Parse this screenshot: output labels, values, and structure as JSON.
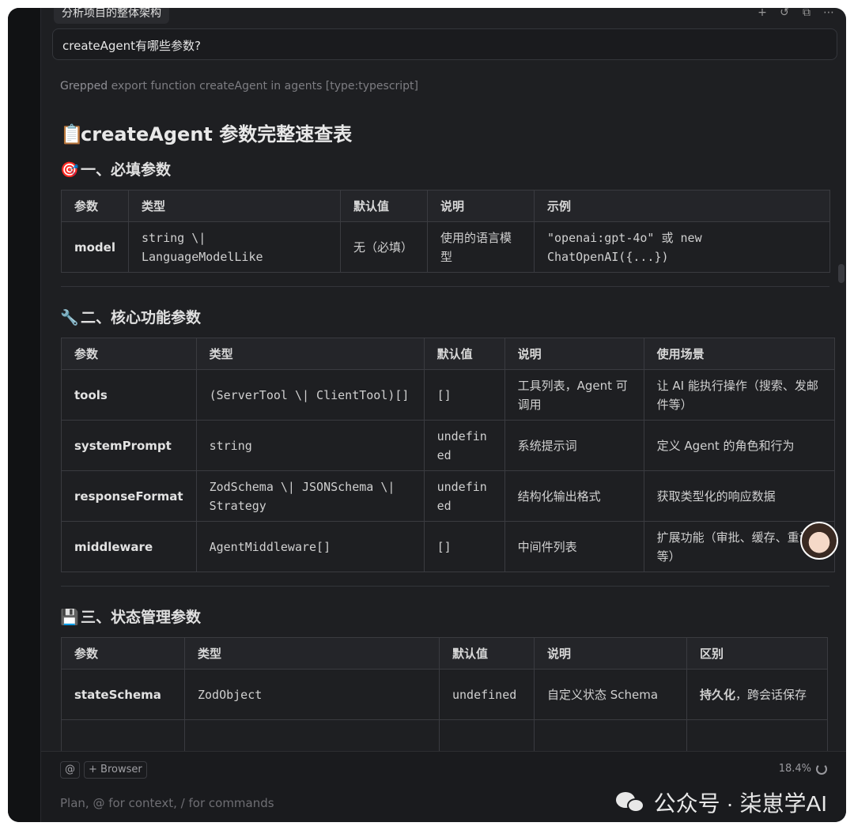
{
  "window": {
    "tab_title": "分析项目的整体架构",
    "top_icons": [
      "plus-icon",
      "history-icon",
      "popout-icon",
      "more-icon"
    ]
  },
  "query": "createAgent有哪些参数?",
  "grepped": {
    "verb": "Grepped",
    "detail": "export function createAgent in agents [type:typescript]"
  },
  "heading": {
    "emoji": "📋",
    "text": "createAgent 参数完整速查表"
  },
  "sections": {
    "required": {
      "emoji": "🎯",
      "title": "一、必填参数",
      "headers": [
        "参数",
        "类型",
        "默认值",
        "说明",
        "示例"
      ],
      "rows": [
        [
          "model",
          "string \\| LanguageModelLike",
          "无（必填）",
          "使用的语言模型",
          "\"openai:gpt-4o\" 或 new ChatOpenAI({...})"
        ]
      ]
    },
    "core": {
      "emoji": "🔧",
      "title": "二、核心功能参数",
      "headers": [
        "参数",
        "类型",
        "默认值",
        "说明",
        "使用场景"
      ],
      "rows": [
        [
          "tools",
          "(ServerTool \\| ClientTool)[]",
          "[]",
          "工具列表，Agent 可调用",
          "让 AI 能执行操作（搜索、发邮件等）"
        ],
        [
          "systemPrompt",
          "string",
          "undefined",
          "系统提示词",
          "定义 Agent 的角色和行为"
        ],
        [
          "responseFormat",
          "ZodSchema \\| JSONSchema \\| Strategy",
          "undefined",
          "结构化输出格式",
          "获取类型化的响应数据"
        ],
        [
          "middleware",
          "AgentMiddleware[]",
          "[]",
          "中间件列表",
          "扩展功能（审批、缓存、重试等）"
        ]
      ]
    },
    "state": {
      "emoji": "💾",
      "title": "三、状态管理参数",
      "headers": [
        "参数",
        "类型",
        "默认值",
        "说明",
        "区别"
      ],
      "rows": [
        [
          "stateSchema",
          "ZodObject",
          "undefined",
          "自定义状态 Schema",
          "持久化，跨会话保存"
        ]
      ],
      "row_diff_bold": "持久化"
    }
  },
  "bottom": {
    "at_label": "@",
    "browser_label": "+ Browser",
    "percent": "18.4%",
    "placeholder": "Plan, @ for context, / for commands"
  },
  "watermark": "公众号 · 柒崽学AI"
}
